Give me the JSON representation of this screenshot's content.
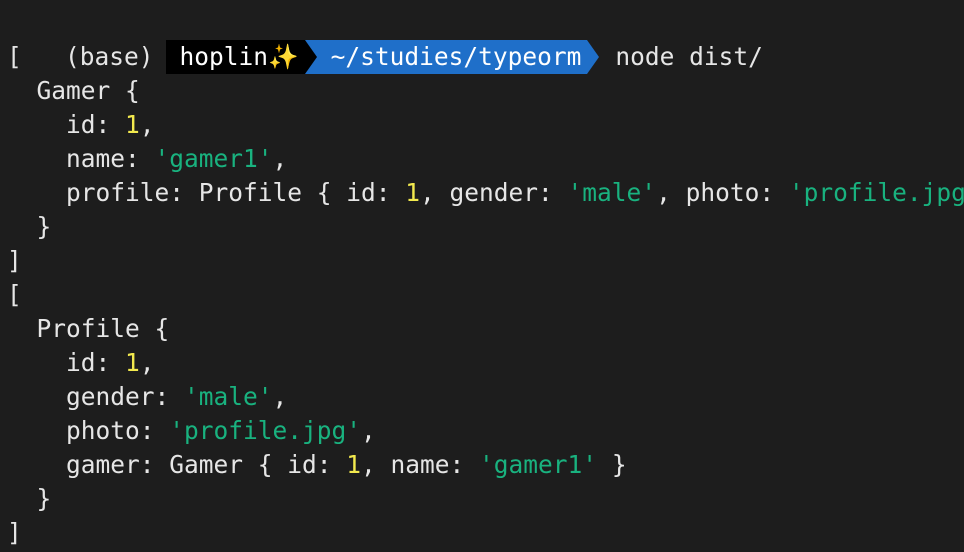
{
  "prompt": {
    "env": "(base)",
    "user": "hoplin",
    "sparkle": "✨",
    "path": "~/studies/typeorm",
    "command": "node dist/"
  },
  "output": [
    [
      {
        "t": "["
      }
    ],
    [
      {
        "t": "  Gamer {"
      }
    ],
    [
      {
        "t": "    id: "
      },
      {
        "t": "1",
        "c": "num"
      },
      {
        "t": ","
      }
    ],
    [
      {
        "t": "    name: "
      },
      {
        "t": "'gamer1'",
        "c": "str"
      },
      {
        "t": ","
      }
    ],
    [
      {
        "t": "    profile: Profile { id: "
      },
      {
        "t": "1",
        "c": "num"
      },
      {
        "t": ", gender: "
      },
      {
        "t": "'male'",
        "c": "str"
      },
      {
        "t": ", photo: "
      },
      {
        "t": "'profile.jpg'",
        "c": "str"
      },
      {
        "t": " }"
      }
    ],
    [
      {
        "t": "  }"
      }
    ],
    [
      {
        "t": "]"
      }
    ],
    [
      {
        "t": "["
      }
    ],
    [
      {
        "t": "  Profile {"
      }
    ],
    [
      {
        "t": "    id: "
      },
      {
        "t": "1",
        "c": "num"
      },
      {
        "t": ","
      }
    ],
    [
      {
        "t": "    gender: "
      },
      {
        "t": "'male'",
        "c": "str"
      },
      {
        "t": ","
      }
    ],
    [
      {
        "t": "    photo: "
      },
      {
        "t": "'profile.jpg'",
        "c": "str"
      },
      {
        "t": ","
      }
    ],
    [
      {
        "t": "    gamer: Gamer { id: "
      },
      {
        "t": "1",
        "c": "num"
      },
      {
        "t": ", name: "
      },
      {
        "t": "'gamer1'",
        "c": "str"
      },
      {
        "t": " }"
      }
    ],
    [
      {
        "t": "  }"
      }
    ],
    [
      {
        "t": "]"
      }
    ]
  ]
}
